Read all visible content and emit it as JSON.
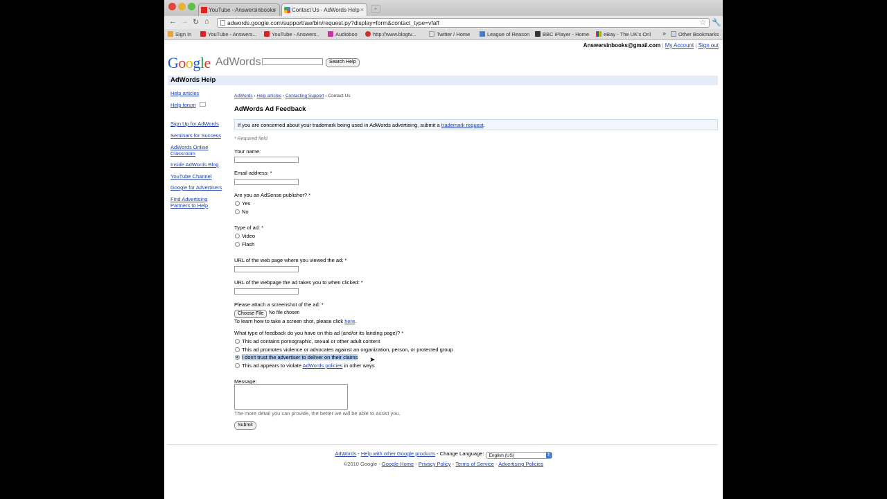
{
  "browser": {
    "tabs": [
      {
        "label": "YouTube - Answersinbooks"
      },
      {
        "label": "Contact Us - AdWords Help"
      }
    ],
    "url": "adwords.google.com/support/aw/bin/request.py?display=form&contact_type=vfaff",
    "bookmarks": [
      {
        "label": "Sign In"
      },
      {
        "label": "YouTube - Answers..."
      },
      {
        "label": "YouTube - Answers..."
      },
      {
        "label": "Audioboo"
      },
      {
        "label": "http://www.blogtv..."
      },
      {
        "label": "Twitter / Home"
      },
      {
        "label": "League of Reason"
      },
      {
        "label": "BBC iPlayer - Home"
      },
      {
        "label": "eBay - The UK's Onl..."
      }
    ],
    "other_bookmarks": "Other Bookmarks",
    "more_bookmarks": "»"
  },
  "header": {
    "account_email": "Answersinbooks@gmail.com",
    "my_account": "My Account",
    "sign_out": "Sign out",
    "separator": "|",
    "logo": "Google",
    "product": "AdWords",
    "search_button": "Search Help",
    "help_title": "AdWords Help"
  },
  "colors": {
    "logo_blue": "#1c57d3",
    "logo_red": "#d53a2c",
    "logo_yellow": "#f2b600",
    "logo_green": "#2e9b3f",
    "link": "#1f3fae",
    "help_bar": "#e5ecf9"
  },
  "sidebar": {
    "items": [
      {
        "label": "Help articles"
      },
      {
        "label": "Help forum"
      },
      {
        "label": "Sign Up for AdWords"
      },
      {
        "label": "Seminars for Success"
      },
      {
        "label": "AdWords Online Classroom"
      },
      {
        "label": "Inside AdWords Blog"
      },
      {
        "label": "YouTube Channel"
      },
      {
        "label": "Google for Advertisers"
      },
      {
        "label": "Find Advertising Partners to Help"
      }
    ]
  },
  "main": {
    "breadcrumb": [
      {
        "label": "AdWords"
      },
      {
        "label": "Help articles"
      },
      {
        "label": "Contacting Support"
      },
      {
        "label": "Contact Us"
      }
    ],
    "breadcrumb_sep": "›",
    "title": "AdWords Ad Feedback",
    "notice_text": "If you are concerned about your trademark being used in AdWords advertising, submit a",
    "notice_link": "trademark request",
    "notice_end": ".",
    "required_note": "* Required field",
    "form": {
      "name_label": "Your name:",
      "email_label": "Email address: *",
      "adsense_label": "Are you an AdSense publisher? *",
      "adsense_options": [
        "Yes",
        "No"
      ],
      "adtype_label": "Type of ad: *",
      "adtype_options": [
        "Video",
        "Flash"
      ],
      "url_viewed_label": "URL of the web page where you viewed the ad: *",
      "url_clicked_label": "URL of the webpage the ad takes you to when clicked: *",
      "screenshot_label": "Please attach a screenshot of the ad: *",
      "choose_file": "Choose File",
      "no_file": "No file chosen",
      "screenshot_help": "To learn how to take a screen shot, please click",
      "screenshot_help_link": "here",
      "screenshot_help_end": ".",
      "feedback_label": "What type of feedback do you have on this ad (and/or its landing page)? *",
      "feedback_options": [
        "This ad contains pornographic, sexual or other adult content",
        "This ad promotes violence or advocates against an organization, person, or protected group",
        "I don't trust the advertiser to deliver on their claims",
        "This ad appears to violate"
      ],
      "feedback_option4_link": "AdWords policies",
      "feedback_option4_end": "in other ways",
      "feedback_selected_index": 2,
      "message_label": "Message:",
      "message_help": "The more detail you can provide, the better we will be able to assist you.",
      "submit": "Submit"
    }
  },
  "footer": {
    "adwords": "AdWords",
    "help_other": "Help with other Google products",
    "change_language": "Change Language:",
    "language": "English (US)",
    "copyright": "©2010 Google",
    "google_home": "Google Home",
    "privacy": "Privacy Policy",
    "terms": "Terms of Service",
    "ad_policies": "Advertising Policies",
    "dash": "-"
  }
}
